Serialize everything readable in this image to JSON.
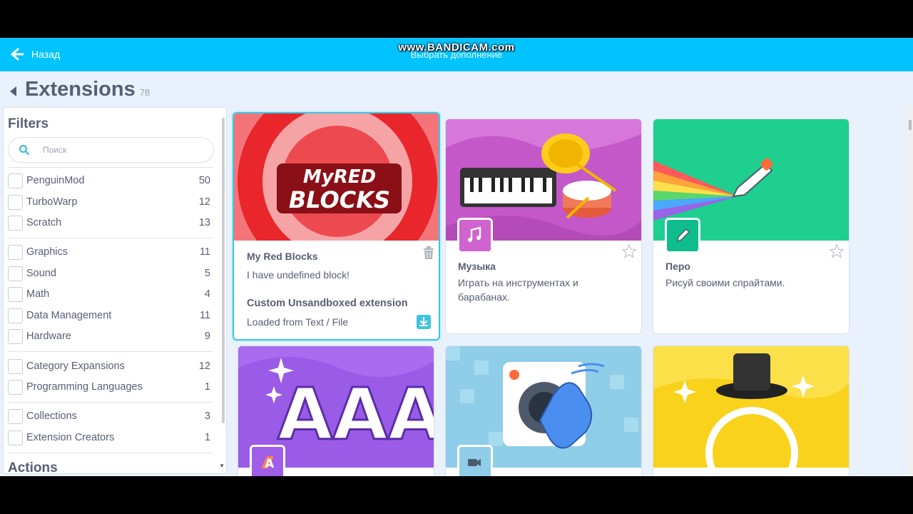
{
  "watermark": "www.BANDICAM.com",
  "header": {
    "back_label": "Назад",
    "title": "Выбрать дополнение"
  },
  "page": {
    "title": "Extensions",
    "count": "78"
  },
  "filters": {
    "title": "Filters",
    "search_placeholder": "Поиск",
    "groups": [
      [
        {
          "label": "PenguinMod",
          "count": "50"
        },
        {
          "label": "TurboWarp",
          "count": "12"
        },
        {
          "label": "Scratch",
          "count": "13"
        }
      ],
      [
        {
          "label": "Graphics",
          "count": "11"
        },
        {
          "label": "Sound",
          "count": "5"
        },
        {
          "label": "Math",
          "count": "4"
        },
        {
          "label": "Data Management",
          "count": "11"
        },
        {
          "label": "Hardware",
          "count": "9"
        }
      ],
      [
        {
          "label": "Category Expansions",
          "count": "12"
        },
        {
          "label": "Programming Languages",
          "count": "1"
        }
      ],
      [
        {
          "label": "Collections",
          "count": "3"
        },
        {
          "label": "Extension Creators",
          "count": "1"
        }
      ]
    ],
    "actions_title": "Actions"
  },
  "cards": [
    {
      "name": "My Red Blocks",
      "description": "I have undefined block!",
      "art_text_line1": "MyRED",
      "art_text_line2": "BLOCKS",
      "extra_title": "Custom Unsandboxed extension",
      "extra_sub": "Loaded from Text / File",
      "selected": true
    },
    {
      "name": "Музыка",
      "description": "Играть на инструментах и барабанах.",
      "color": "#cf63cf"
    },
    {
      "name": "Перо",
      "description": "Рисуй своими спрайтами.",
      "color": "#0fbd8c"
    },
    {
      "art_text": "AAAAA",
      "color": "#9f5ee8"
    },
    {
      "color": "#8fcde8"
    },
    {
      "color": "#f9d21b"
    }
  ]
}
